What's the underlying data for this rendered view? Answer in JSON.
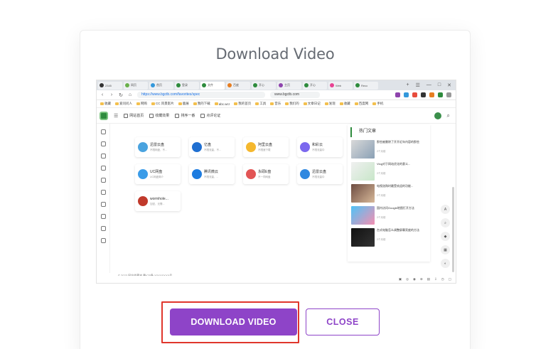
{
  "dialog": {
    "title": "Download Video",
    "download_label": "DOWNLOAD VIDEO",
    "close_label": "CLOSE",
    "accent_color": "#8e44c8",
    "highlight_color": "#e0362c"
  },
  "preview": {
    "tabs": [
      "2345",
      "网页",
      "首页",
      "登录",
      "文件",
      "百度",
      "开心",
      "主页",
      "开心",
      "Web",
      "Reco"
    ],
    "url": "https://www.bgctb.com/favorites/spec",
    "url2": "www.bgctb.com",
    "bookmarks": [
      "收藏",
      "爱问问人",
      "网购",
      "CC 风景影片",
      "鹿展",
      "我的下载",
      "abc.wcr",
      "我的首页",
      "工具",
      "音乐",
      "我们的",
      "文章日记",
      "发现",
      "收藏",
      "百度网",
      "手机"
    ],
    "site_nav": [
      "网站首页",
      "收藏效果",
      "排序一番",
      "点评论证"
    ],
    "cards": [
      {
        "name": "迅雷云盘",
        "desc": "不限网盘，不..."
      },
      {
        "name": "亿盘",
        "desc": "不限流量，不..."
      },
      {
        "name": "阿里云盘",
        "desc": "不限速下载"
      },
      {
        "name": "和彩云",
        "desc": "不限流量中"
      },
      {
        "name": "UC网盘",
        "desc": "UC网盘简介"
      },
      {
        "name": "腾讯微云",
        "desc": "不限流量，..."
      },
      {
        "name": "永硕E盘",
        "desc": "不一同网盘"
      },
      {
        "name": "迅雷云盘",
        "desc": "不限流量中"
      },
      {
        "name": "wormhole...",
        "desc": "加密，无需..."
      }
    ],
    "panel_title": "热门文章",
    "articles": [
      {
        "title": "那些被删除了开开近年内容的那些",
        "meta": "2个月前"
      },
      {
        "title": "Vlog对于网站优化的意义...",
        "meta": "2个月前"
      },
      {
        "title": "电视选购时最受欢迎的功能...",
        "meta": "2个月前"
      },
      {
        "title": "国内访问Google地图打开方法",
        "meta": "2个月前"
      },
      {
        "title": "台式电脑怎么调整屏幕亮度的方法",
        "meta": "2个月前"
      }
    ],
    "footer": "© 2023 网站收藏夹 粤ICP备 XXXXXXXX号"
  }
}
